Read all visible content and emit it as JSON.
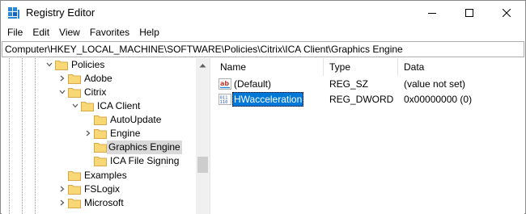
{
  "window": {
    "title": "Registry Editor",
    "accent_color": "#0078d7"
  },
  "menu": [
    "File",
    "Edit",
    "View",
    "Favorites",
    "Help"
  ],
  "address": "Computer\\HKEY_LOCAL_MACHINE\\SOFTWARE\\Policies\\Citrix\\ICA Client\\Graphics Engine",
  "tree": {
    "items": [
      {
        "label": "Policies",
        "depth": 0,
        "expander": "expanded"
      },
      {
        "label": "Adobe",
        "depth": 1,
        "expander": "collapsed"
      },
      {
        "label": "Citrix",
        "depth": 1,
        "expander": "expanded"
      },
      {
        "label": "ICA Client",
        "depth": 2,
        "expander": "expanded"
      },
      {
        "label": "AutoUpdate",
        "depth": 3,
        "expander": "none"
      },
      {
        "label": "Engine",
        "depth": 3,
        "expander": "collapsed"
      },
      {
        "label": "Graphics Engine",
        "depth": 3,
        "expander": "none",
        "selected": true
      },
      {
        "label": "ICA File Signing",
        "depth": 3,
        "expander": "none"
      },
      {
        "label": "Examples",
        "depth": 1,
        "expander": "none"
      },
      {
        "label": "FSLogix",
        "depth": 1,
        "expander": "collapsed"
      },
      {
        "label": "Microsoft",
        "depth": 1,
        "expander": "collapsed"
      }
    ]
  },
  "list": {
    "columns": [
      "Name",
      "Type",
      "Data"
    ],
    "rows": [
      {
        "name": "(Default)",
        "type": "REG_SZ",
        "data": "(value not set)",
        "icon": "string-value-icon",
        "selected": false
      },
      {
        "name": "HWacceleration",
        "type": "REG_DWORD",
        "data": "0x00000000 (0)",
        "icon": "binary-value-icon",
        "selected": true
      }
    ]
  }
}
